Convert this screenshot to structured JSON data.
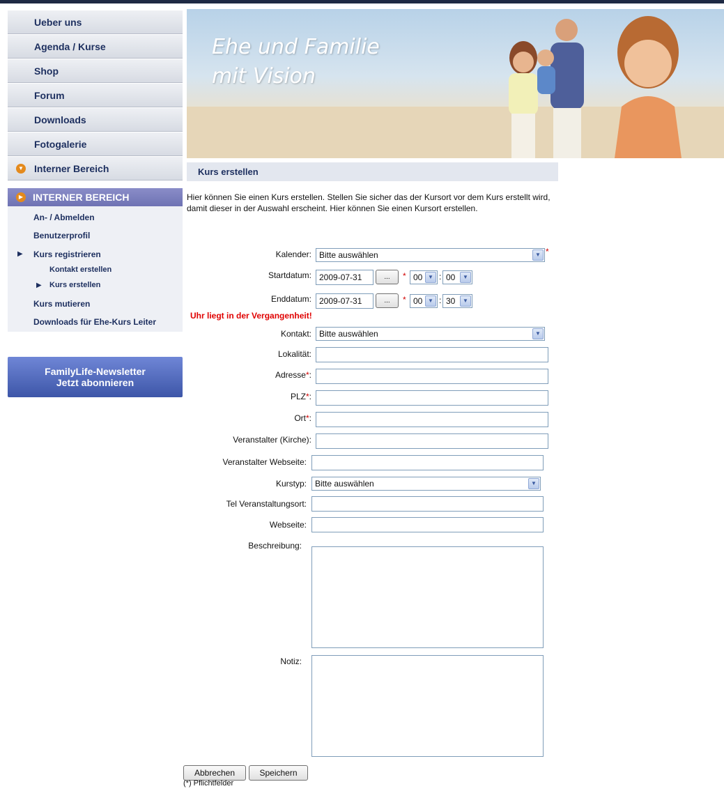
{
  "nav": {
    "items": [
      {
        "label": "Ueber uns"
      },
      {
        "label": "Agenda / Kurse"
      },
      {
        "label": "Shop"
      },
      {
        "label": "Forum"
      },
      {
        "label": "Downloads"
      },
      {
        "label": "Fotogalerie"
      },
      {
        "label": "Interner Bereich"
      }
    ]
  },
  "internal": {
    "header": "INTERNER BEREICH",
    "items": {
      "login": "An- / Abmelden",
      "profile": "Benutzerprofil",
      "register_course": "Kurs registrieren",
      "create_contact": "Kontakt erstellen",
      "create_course": "Kurs erstellen",
      "modify_course": "Kurs mutieren",
      "downloads_leaders": "Downloads für Ehe-Kurs Leiter"
    }
  },
  "newsletter": {
    "line1": "FamilyLife-Newsletter",
    "line2": "Jetzt abonnieren"
  },
  "banner": {
    "line1": "Ehe und Familie",
    "line2": "mit Vision"
  },
  "section": {
    "title": "Kurs erstellen",
    "intro": "Hier können Sie einen Kurs erstellen. Stellen Sie sicher das der Kursort vor dem Kurs erstellt wird, damit dieser in der Auswahl erscheint. Hier können Sie einen Kursort erstellen."
  },
  "form": {
    "kalender": {
      "label": "Kalender:",
      "value": "Bitte auswählen"
    },
    "start": {
      "label": "Startdatum:",
      "date": "2009-07-31",
      "hour": "00",
      "minute": "00"
    },
    "end": {
      "label": "Enddatum:",
      "date": "2009-07-31",
      "hour": "00",
      "minute": "30"
    },
    "picker_label": "...",
    "error": "Uhr liegt in der Vergangenheit!",
    "kontakt": {
      "label": "Kontakt:",
      "value": "Bitte auswählen"
    },
    "lokalitaet": {
      "label": "Lokalität:"
    },
    "adresse": {
      "label": "Adresse"
    },
    "plz": {
      "label": "PLZ"
    },
    "ort": {
      "label": "Ort"
    },
    "veranstalter": {
      "label": "Veranstalter (Kirche):"
    },
    "veranstalter_web": {
      "label": "Veranstalter Webseite:"
    },
    "kurstyp": {
      "label": "Kurstyp:",
      "value": "Bitte auswählen"
    },
    "tel": {
      "label": "Tel Veranstaltungsort:"
    },
    "webseite": {
      "label": "Webseite:"
    },
    "beschreibung": {
      "label": "Beschreibung:"
    },
    "notiz": {
      "label": "Notiz:"
    },
    "required_mark": "*",
    "colon": ":",
    "cancel": "Abbrechen",
    "save": "Speichern",
    "footnote": "(*) Pflichtfelder"
  },
  "icons": {
    "dropdown": "chevron-down-icon",
    "bullet": "triangle-right-icon",
    "circle": "orange-circle-arrow-icon"
  },
  "colors": {
    "nav_text": "#1d2f5f",
    "accent_orange": "#e48a1d",
    "error_red": "#e00000",
    "internal_header": "#6e72b3"
  }
}
